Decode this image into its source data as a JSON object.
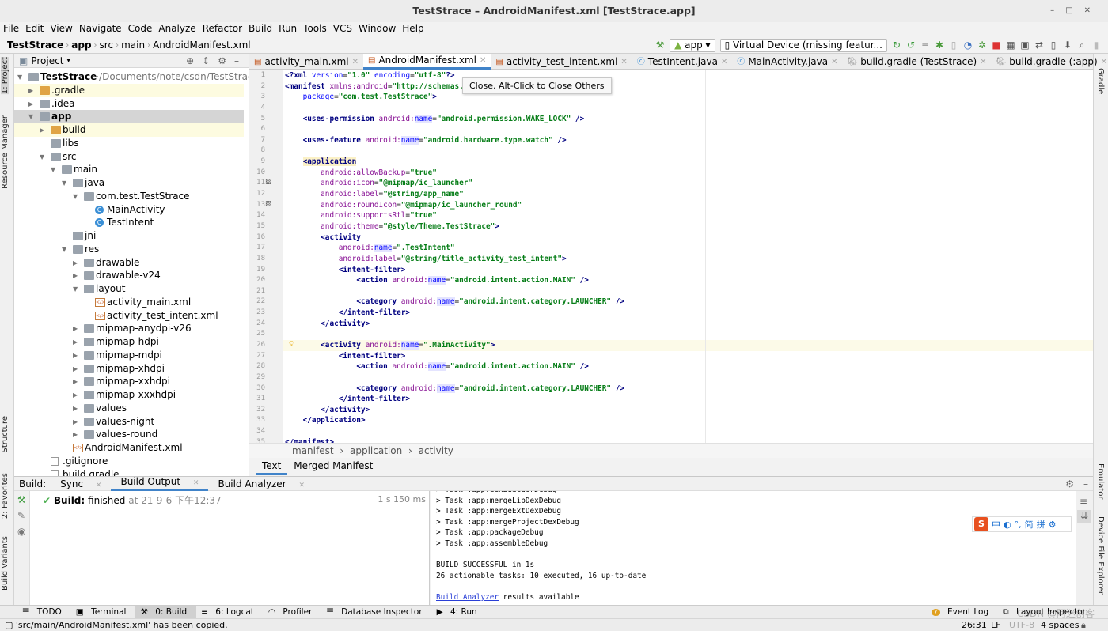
{
  "window": {
    "title": "TestStrace – AndroidManifest.xml [TestStrace.app]"
  },
  "menu": [
    "File",
    "Edit",
    "View",
    "Navigate",
    "Code",
    "Analyze",
    "Refactor",
    "Build",
    "Run",
    "Tools",
    "VCS",
    "Window",
    "Help"
  ],
  "nav": {
    "crumbs": [
      "TestStrace",
      "app",
      "src",
      "main",
      "AndroidManifest.xml"
    ],
    "config": "app",
    "device": "Virtual Device (missing featur..."
  },
  "project": {
    "header": "Project",
    "tree": [
      {
        "label": "TestStrace",
        "suffix": "~/Documents/note/csdn/TestStrace",
        "level": 0,
        "expanded": true,
        "icon": "folder",
        "bold": true
      },
      {
        "label": ".gradle",
        "level": 1,
        "expanded": false,
        "icon": "folder-orange",
        "highlight": true
      },
      {
        "label": ".idea",
        "level": 1,
        "expanded": false,
        "icon": "folder"
      },
      {
        "label": "app",
        "level": 1,
        "expanded": true,
        "icon": "folder",
        "bold": true,
        "selected": true
      },
      {
        "label": "build",
        "level": 2,
        "expanded": false,
        "icon": "folder-orange",
        "highlight": true
      },
      {
        "label": "libs",
        "level": 2,
        "icon": "folder"
      },
      {
        "label": "src",
        "level": 2,
        "expanded": true,
        "icon": "folder"
      },
      {
        "label": "main",
        "level": 3,
        "expanded": true,
        "icon": "folder"
      },
      {
        "label": "java",
        "level": 4,
        "expanded": true,
        "icon": "folder"
      },
      {
        "label": "com.test.TestStrace",
        "level": 5,
        "expanded": true,
        "icon": "folder"
      },
      {
        "label": "MainActivity",
        "level": 6,
        "icon": "class"
      },
      {
        "label": "TestIntent",
        "level": 6,
        "icon": "class"
      },
      {
        "label": "jni",
        "level": 4,
        "icon": "folder"
      },
      {
        "label": "res",
        "level": 4,
        "expanded": true,
        "icon": "folder"
      },
      {
        "label": "drawable",
        "level": 5,
        "expanded": false,
        "icon": "folder"
      },
      {
        "label": "drawable-v24",
        "level": 5,
        "expanded": false,
        "icon": "folder"
      },
      {
        "label": "layout",
        "level": 5,
        "expanded": true,
        "icon": "folder"
      },
      {
        "label": "activity_main.xml",
        "level": 6,
        "icon": "xml"
      },
      {
        "label": "activity_test_intent.xml",
        "level": 6,
        "icon": "xml"
      },
      {
        "label": "mipmap-anydpi-v26",
        "level": 5,
        "expanded": false,
        "icon": "folder"
      },
      {
        "label": "mipmap-hdpi",
        "level": 5,
        "expanded": false,
        "icon": "folder"
      },
      {
        "label": "mipmap-mdpi",
        "level": 5,
        "expanded": false,
        "icon": "folder"
      },
      {
        "label": "mipmap-xhdpi",
        "level": 5,
        "expanded": false,
        "icon": "folder"
      },
      {
        "label": "mipmap-xxhdpi",
        "level": 5,
        "expanded": false,
        "icon": "folder"
      },
      {
        "label": "mipmap-xxxhdpi",
        "level": 5,
        "expanded": false,
        "icon": "folder"
      },
      {
        "label": "values",
        "level": 5,
        "expanded": false,
        "icon": "folder"
      },
      {
        "label": "values-night",
        "level": 5,
        "expanded": false,
        "icon": "folder"
      },
      {
        "label": "values-round",
        "level": 5,
        "expanded": false,
        "icon": "folder"
      },
      {
        "label": "AndroidManifest.xml",
        "level": 4,
        "icon": "xml"
      },
      {
        "label": ".gitignore",
        "level": 2,
        "icon": "file"
      },
      {
        "label": "build.gradle",
        "level": 2,
        "icon": "gradle"
      }
    ]
  },
  "editor_tabs": [
    {
      "label": "activity_main.xml",
      "icon": "xml"
    },
    {
      "label": "AndroidManifest.xml",
      "icon": "xml",
      "active": true
    },
    {
      "label": "activity_test_intent.xml",
      "icon": "xml"
    },
    {
      "label": "TestIntent.java",
      "icon": "class"
    },
    {
      "label": "MainActivity.java",
      "icon": "class"
    },
    {
      "label": "build.gradle (TestStrace)",
      "icon": "gradle"
    },
    {
      "label": "build.gradle (:app)",
      "icon": "gradle"
    }
  ],
  "tooltip": "Close. Alt-Click to Close Others",
  "code": {
    "current_line": 26,
    "lines": [
      "<?xml version=\"1.0\" encoding=\"utf-8\"?>",
      "<manifest xmlns:android=\"http://schemas.an",
      "    package=\"com.test.TestStrace\">",
      "",
      "    <uses-permission android:name=\"android.permission.WAKE_LOCK\" />",
      "",
      "    <uses-feature android:name=\"android.hardware.type.watch\" />",
      "",
      "    <application",
      "        android:allowBackup=\"true\"",
      "        android:icon=\"@mipmap/ic_launcher\"",
      "        android:label=\"@string/app_name\"",
      "        android:roundIcon=\"@mipmap/ic_launcher_round\"",
      "        android:supportsRtl=\"true\"",
      "        android:theme=\"@style/Theme.TestStrace\">",
      "        <activity",
      "            android:name=\".TestIntent\"",
      "            android:label=\"@string/title_activity_test_intent\">",
      "            <intent-filter>",
      "                <action android:name=\"android.intent.action.MAIN\" />",
      "",
      "                <category android:name=\"android.intent.category.LAUNCHER\" />",
      "            </intent-filter>",
      "        </activity>",
      "",
      "        <activity android:name=\".MainActivity\">",
      "            <intent-filter>",
      "                <action android:name=\"android.intent.action.MAIN\" />",
      "",
      "                <category android:name=\"android.intent.category.LAUNCHER\" />",
      "            </intent-filter>",
      "        </activity>",
      "    </application>",
      "",
      "</manifest>"
    ]
  },
  "editor_breadcrumb": [
    "manifest",
    "application",
    "activity"
  ],
  "mode_tabs": [
    "Text",
    "Merged Manifest"
  ],
  "build": {
    "label": "Build:",
    "tabs": [
      "Sync",
      "Build Output",
      "Build Analyzer"
    ],
    "status_bold": "Build:",
    "status": "finished",
    "time": "at 21-9-6 下午12:37",
    "duration": "1 s 150 ms",
    "console": [
      "> Task :app:dexBuilderDebug",
      "> Task :app:mergeLibDexDebug",
      "> Task :app:mergeExtDexDebug",
      "> Task :app:mergeProjectDexDebug",
      "> Task :app:packageDebug",
      "> Task :app:assembleDebug",
      "",
      "BUILD SUCCESSFUL in 1s",
      "26 actionable tasks: 10 executed, 16 up-to-date",
      ""
    ],
    "link": "Build Analyzer",
    "link_suffix": " results available"
  },
  "ime": [
    "中",
    "◐",
    "°,",
    "简",
    "拼",
    "⚙"
  ],
  "left_strip": [
    "1: Project",
    "Resource Manager",
    "Structure",
    "2: Favorites",
    "Build Variants"
  ],
  "right_strip": [
    "Gradle",
    "Emulator",
    "Device File Explorer"
  ],
  "tool_tabs": [
    "TODO",
    "Terminal",
    "0: Build",
    "6: Logcat",
    "Profiler",
    "Database Inspector",
    "4: Run"
  ],
  "tool_tabs_right": [
    "Event Log",
    "Layout Inspector"
  ],
  "event_count": "7",
  "status": {
    "message": "'src/main/AndroidManifest.xml' has been copied.",
    "position": "26:31",
    "line_sep": "LF",
    "encoding": "UTF-8",
    "indent": "4 spaces"
  },
  "watermark": "CSDN @阿迷创客"
}
